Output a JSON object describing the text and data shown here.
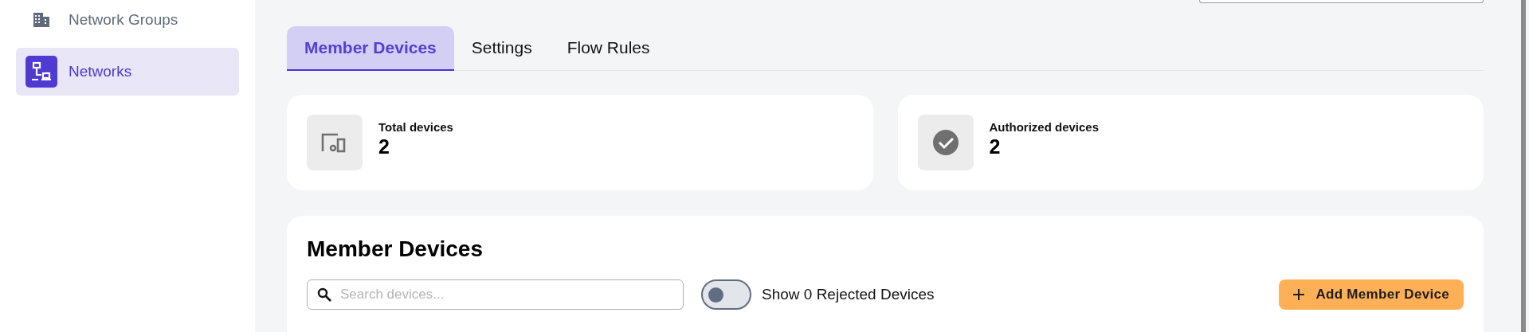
{
  "sidebar": {
    "items": [
      {
        "label": "Network Groups",
        "kind": "building",
        "selected": false
      },
      {
        "label": "Networks",
        "kind": "network",
        "selected": true
      }
    ]
  },
  "tabs": [
    {
      "label": "Member Devices",
      "selected": true
    },
    {
      "label": "Settings",
      "selected": false
    },
    {
      "label": "Flow Rules",
      "selected": false
    }
  ],
  "stats": [
    {
      "label": "Total devices",
      "value": "2",
      "kind": "devices"
    },
    {
      "label": "Authorized devices",
      "value": "2",
      "kind": "check"
    }
  ],
  "members": {
    "title": "Member Devices",
    "search": {
      "placeholder": "Search devices..."
    },
    "toggle": {
      "label": "Show 0 Rejected Devices",
      "on": false
    },
    "add_button": "Add Member Device"
  }
}
